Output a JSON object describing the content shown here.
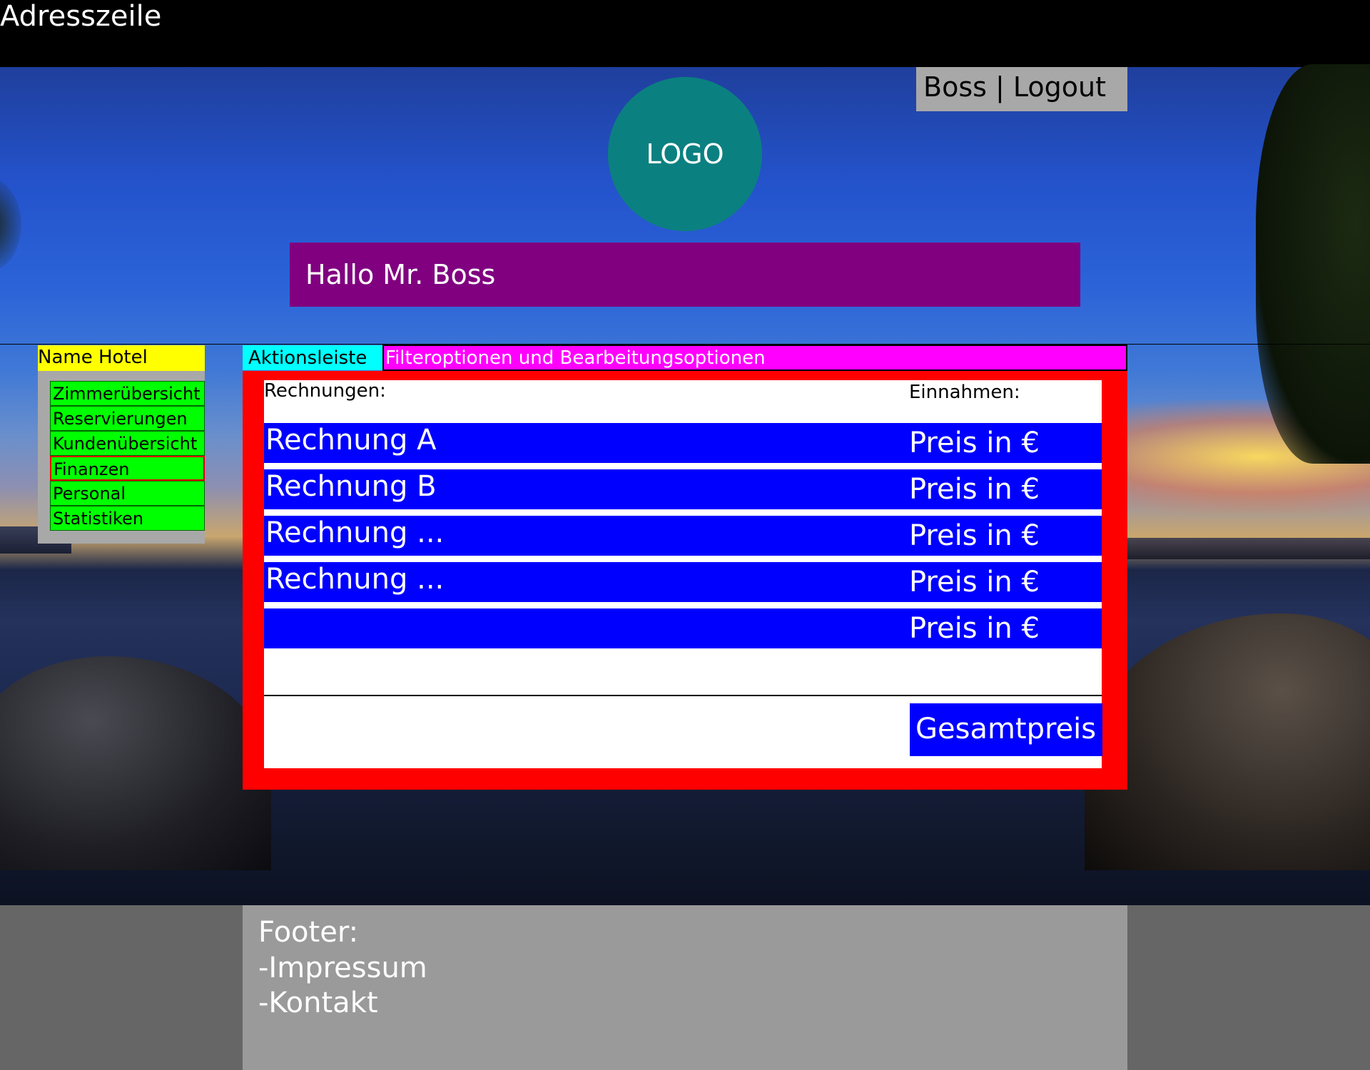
{
  "browser": {
    "address_bar": "Adresszeile"
  },
  "header": {
    "user_menu": "Boss | Logout",
    "logo": "LOGO",
    "greeting": "Hallo Mr. Boss"
  },
  "sidebar": {
    "hotel_name": "Name Hotel",
    "items": [
      {
        "label": "Zimmerübersicht"
      },
      {
        "label": "Reservierungen"
      },
      {
        "label": "Kundenübersicht"
      },
      {
        "label": "Finanzen",
        "active": true
      },
      {
        "label": "Personal"
      },
      {
        "label": "Statistiken"
      }
    ]
  },
  "toolbar": {
    "action_bar": "Aktionsleiste",
    "filter_options": "Filteroptionen und Bearbeitungsoptionen"
  },
  "finance": {
    "header_left": "Rechnungen:",
    "header_right": "Einnahmen:",
    "rows": [
      {
        "name": "Rechnung A",
        "price": "Preis in €"
      },
      {
        "name": "Rechnung B",
        "price": "Preis in €"
      },
      {
        "name": "Rechnung ...",
        "price": "Preis in €"
      },
      {
        "name": "Rechnung ...",
        "price": "Preis in €"
      },
      {
        "name": "",
        "price": "Preis in €"
      }
    ],
    "total_label": "Gesamtpreis"
  },
  "footer": {
    "title": "Footer:",
    "links": [
      "-Impressum",
      "-Kontakt"
    ]
  },
  "colors": {
    "greeting_bg": "#800080",
    "logo_bg": "#0b8080",
    "hotel_name_bg": "#ffff00",
    "nav_bg": "#00ff00",
    "action_bar_bg": "#00ffff",
    "filter_bar_bg": "#ff00ff",
    "main_border": "#ff0000",
    "row_bg": "#0000ff"
  }
}
